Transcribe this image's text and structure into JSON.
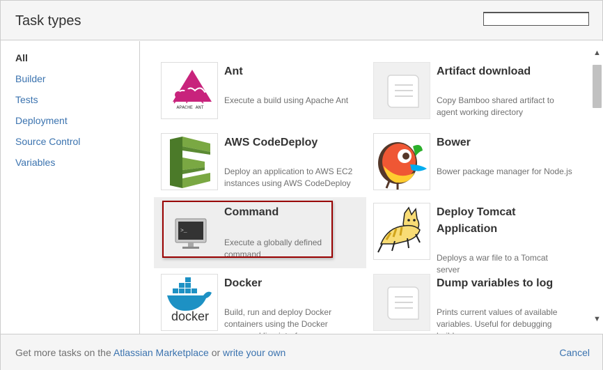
{
  "header": {
    "title": "Task types",
    "search_value": ""
  },
  "sidebar": {
    "items": [
      {
        "label": "All",
        "active": true
      },
      {
        "label": "Builder"
      },
      {
        "label": "Tests"
      },
      {
        "label": "Deployment"
      },
      {
        "label": "Source Control"
      },
      {
        "label": "Variables"
      }
    ]
  },
  "tasks": [
    {
      "title": "Ant",
      "description": "Execute a build using Apache Ant",
      "icon": "apache-ant-logo",
      "logo_text": "APACHE ANT"
    },
    {
      "title": "Artifact download",
      "description": "Copy Bamboo shared artifact to agent working directory",
      "icon": "document-scroll-icon"
    },
    {
      "title": "AWS CodeDeploy",
      "description": "Deploy an application to AWS EC2 instances using AWS CodeDeploy",
      "icon": "aws-codedeploy-logo"
    },
    {
      "title": "Bower",
      "description": "Bower package manager for Node.js",
      "icon": "bower-bird-logo"
    },
    {
      "title": "Command",
      "description": "Execute a globally defined command",
      "icon": "terminal-monitor-icon",
      "hovered": true,
      "selected": true
    },
    {
      "title": "Deploy Tomcat Application",
      "description": "Deploys a war file to a Tomcat server",
      "icon": "tomcat-cat-logo"
    },
    {
      "title": "Docker",
      "description": "Build, run and deploy Docker containers using the Docker command line interface",
      "icon": "docker-whale-logo",
      "logo_text": "docker"
    },
    {
      "title": "Dump variables to log",
      "description": "Prints current values of available variables. Useful for debugging builds.",
      "icon": "document-scroll-icon"
    }
  ],
  "footer": {
    "prefix": "Get more tasks on the ",
    "marketplace_link": "Atlassian Marketplace",
    "middle": " or ",
    "write_link": "write your own",
    "cancel_label": "Cancel"
  },
  "colors": {
    "link": "#3b73af",
    "selected_outline": "#990000",
    "aws_green": "#6a9a3a",
    "docker_blue": "#1d91c4"
  }
}
